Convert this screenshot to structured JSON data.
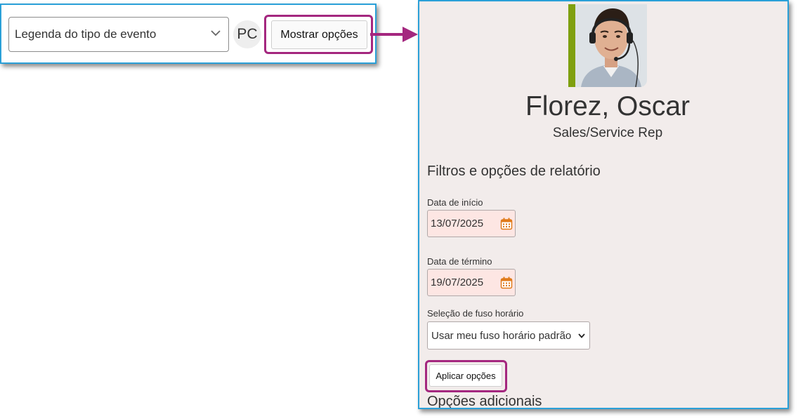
{
  "toolbar": {
    "legend_select_value": "Legenda do tipo de evento",
    "user_initials": "PC",
    "show_options_label": "Mostrar opções"
  },
  "profile": {
    "name": "Florez, Oscar",
    "role": "Sales/Service Rep",
    "photo": "headset-agent-photo"
  },
  "options": {
    "section_title": "Filtros e opções de relatório",
    "start_date_label": "Data de início",
    "start_date_value": "13/07/2025",
    "end_date_label": "Data de término",
    "end_date_value": "19/07/2025",
    "timezone_label": "Seleção de fuso horário",
    "timezone_value": "Usar meu fuso horário padrão",
    "apply_label": "Aplicar opções",
    "more_options_title": "Opções adicionais"
  },
  "colors": {
    "panel_border": "#2aa0d8",
    "highlight": "#a4277f",
    "photo_accent": "#7fa010",
    "date_field_bg": "#fde6e3",
    "calendar_icon": "#e07a1a"
  },
  "icons": {
    "select_chevron": "chevron-down-icon",
    "date_picker": "calendar-icon",
    "connector": "arrow-right-icon"
  }
}
